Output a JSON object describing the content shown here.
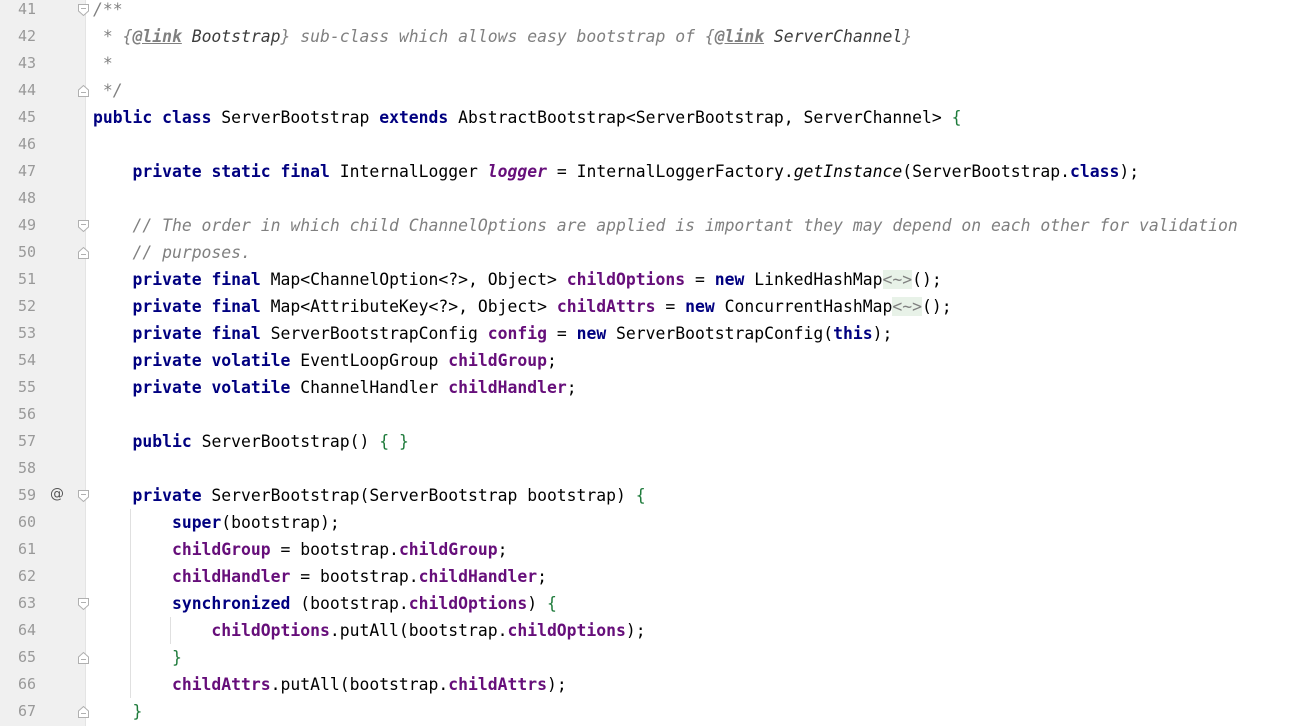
{
  "editor": {
    "line_numbers": [
      "41",
      "42",
      "43",
      "44",
      "45",
      "46",
      "47",
      "48",
      "49",
      "50",
      "51",
      "52",
      "53",
      "54",
      "55",
      "56",
      "57",
      "58",
      "59",
      "60",
      "61",
      "62",
      "63",
      "64",
      "65",
      "66",
      "67"
    ],
    "gutter_icons": {
      "override_marker": "@"
    },
    "lines": [
      [
        {
          "t": "/**",
          "c": "doc"
        }
      ],
      [
        {
          "t": " * {",
          "c": "doc"
        },
        {
          "t": "@link",
          "c": "doc-tag"
        },
        {
          "t": " Bootstrap",
          "c": "doc-link"
        },
        {
          "t": "} sub-class which allows easy bootstrap of {",
          "c": "doc"
        },
        {
          "t": "@link",
          "c": "doc-tag"
        },
        {
          "t": " ServerChannel",
          "c": "doc-link"
        },
        {
          "t": "}",
          "c": "doc"
        }
      ],
      [
        {
          "t": " *",
          "c": "doc"
        }
      ],
      [
        {
          "t": " */",
          "c": "doc"
        }
      ],
      [
        {
          "t": "public",
          "c": "kw"
        },
        {
          "t": " ",
          "c": "plain"
        },
        {
          "t": "class",
          "c": "kw"
        },
        {
          "t": " ServerBootstrap ",
          "c": "plain"
        },
        {
          "t": "extends",
          "c": "kw"
        },
        {
          "t": " AbstractBootstrap<ServerBootstrap, ServerChannel> ",
          "c": "plain"
        },
        {
          "t": "{",
          "c": "brace"
        }
      ],
      [],
      [
        {
          "t": "    ",
          "c": "plain"
        },
        {
          "t": "private",
          "c": "kw"
        },
        {
          "t": " ",
          "c": "plain"
        },
        {
          "t": "static",
          "c": "kw"
        },
        {
          "t": " ",
          "c": "plain"
        },
        {
          "t": "final",
          "c": "kw"
        },
        {
          "t": " InternalLogger ",
          "c": "plain"
        },
        {
          "t": "logger",
          "c": "static-field"
        },
        {
          "t": " = InternalLoggerFactory.",
          "c": "plain"
        },
        {
          "t": "getInstance",
          "c": "method-static"
        },
        {
          "t": "(ServerBootstrap.",
          "c": "plain"
        },
        {
          "t": "class",
          "c": "kw"
        },
        {
          "t": ");",
          "c": "plain"
        }
      ],
      [],
      [
        {
          "t": "    ",
          "c": "plain"
        },
        {
          "t": "// The order in which child ChannelOptions are applied is important they may depend on each other for validation",
          "c": "comment"
        }
      ],
      [
        {
          "t": "    ",
          "c": "plain"
        },
        {
          "t": "// purposes.",
          "c": "comment"
        }
      ],
      [
        {
          "t": "    ",
          "c": "plain"
        },
        {
          "t": "private",
          "c": "kw"
        },
        {
          "t": " ",
          "c": "plain"
        },
        {
          "t": "final",
          "c": "kw"
        },
        {
          "t": " Map<ChannelOption<?>, Object> ",
          "c": "plain"
        },
        {
          "t": "childOptions",
          "c": "field"
        },
        {
          "t": " = ",
          "c": "plain"
        },
        {
          "t": "new",
          "c": "kw"
        },
        {
          "t": " LinkedHashMap",
          "c": "plain"
        },
        {
          "t": "<~>",
          "c": "diamond"
        },
        {
          "t": "();",
          "c": "plain"
        }
      ],
      [
        {
          "t": "    ",
          "c": "plain"
        },
        {
          "t": "private",
          "c": "kw"
        },
        {
          "t": " ",
          "c": "plain"
        },
        {
          "t": "final",
          "c": "kw"
        },
        {
          "t": " Map<AttributeKey<?>, Object> ",
          "c": "plain"
        },
        {
          "t": "childAttrs",
          "c": "field"
        },
        {
          "t": " = ",
          "c": "plain"
        },
        {
          "t": "new",
          "c": "kw"
        },
        {
          "t": " ConcurrentHashMap",
          "c": "plain"
        },
        {
          "t": "<~>",
          "c": "diamond"
        },
        {
          "t": "();",
          "c": "plain"
        }
      ],
      [
        {
          "t": "    ",
          "c": "plain"
        },
        {
          "t": "private",
          "c": "kw"
        },
        {
          "t": " ",
          "c": "plain"
        },
        {
          "t": "final",
          "c": "kw"
        },
        {
          "t": " ServerBootstrapConfig ",
          "c": "plain"
        },
        {
          "t": "config",
          "c": "field"
        },
        {
          "t": " = ",
          "c": "plain"
        },
        {
          "t": "new",
          "c": "kw"
        },
        {
          "t": " ServerBootstrapConfig(",
          "c": "plain"
        },
        {
          "t": "this",
          "c": "kw"
        },
        {
          "t": ");",
          "c": "plain"
        }
      ],
      [
        {
          "t": "    ",
          "c": "plain"
        },
        {
          "t": "private",
          "c": "kw"
        },
        {
          "t": " ",
          "c": "plain"
        },
        {
          "t": "volatile",
          "c": "kw"
        },
        {
          "t": " EventLoopGroup ",
          "c": "plain"
        },
        {
          "t": "childGroup",
          "c": "field"
        },
        {
          "t": ";",
          "c": "plain"
        }
      ],
      [
        {
          "t": "    ",
          "c": "plain"
        },
        {
          "t": "private",
          "c": "kw"
        },
        {
          "t": " ",
          "c": "plain"
        },
        {
          "t": "volatile",
          "c": "kw"
        },
        {
          "t": " ChannelHandler ",
          "c": "plain"
        },
        {
          "t": "childHandler",
          "c": "field"
        },
        {
          "t": ";",
          "c": "plain"
        }
      ],
      [],
      [
        {
          "t": "    ",
          "c": "plain"
        },
        {
          "t": "public",
          "c": "kw"
        },
        {
          "t": " ServerBootstrap() ",
          "c": "plain"
        },
        {
          "t": "{ }",
          "c": "brace"
        }
      ],
      [],
      [
        {
          "t": "    ",
          "c": "plain"
        },
        {
          "t": "private",
          "c": "kw"
        },
        {
          "t": " ServerBootstrap(ServerBootstrap bootstrap) ",
          "c": "plain"
        },
        {
          "t": "{",
          "c": "brace"
        }
      ],
      [
        {
          "t": "        ",
          "c": "plain"
        },
        {
          "t": "super",
          "c": "kw"
        },
        {
          "t": "(bootstrap);",
          "c": "plain"
        }
      ],
      [
        {
          "t": "        ",
          "c": "plain"
        },
        {
          "t": "childGroup",
          "c": "field"
        },
        {
          "t": " = bootstrap.",
          "c": "plain"
        },
        {
          "t": "childGroup",
          "c": "field"
        },
        {
          "t": ";",
          "c": "plain"
        }
      ],
      [
        {
          "t": "        ",
          "c": "plain"
        },
        {
          "t": "childHandler",
          "c": "field"
        },
        {
          "t": " = bootstrap.",
          "c": "plain"
        },
        {
          "t": "childHandler",
          "c": "field"
        },
        {
          "t": ";",
          "c": "plain"
        }
      ],
      [
        {
          "t": "        ",
          "c": "plain"
        },
        {
          "t": "synchronized",
          "c": "kw"
        },
        {
          "t": " (bootstrap.",
          "c": "plain"
        },
        {
          "t": "childOptions",
          "c": "field"
        },
        {
          "t": ") ",
          "c": "plain"
        },
        {
          "t": "{",
          "c": "brace"
        }
      ],
      [
        {
          "t": "            ",
          "c": "plain"
        },
        {
          "t": "childOptions",
          "c": "field"
        },
        {
          "t": ".putAll(bootstrap.",
          "c": "plain"
        },
        {
          "t": "childOptions",
          "c": "field"
        },
        {
          "t": ");",
          "c": "plain"
        }
      ],
      [
        {
          "t": "        ",
          "c": "plain"
        },
        {
          "t": "}",
          "c": "brace"
        }
      ],
      [
        {
          "t": "        ",
          "c": "plain"
        },
        {
          "t": "childAttrs",
          "c": "field"
        },
        {
          "t": ".putAll(bootstrap.",
          "c": "plain"
        },
        {
          "t": "childAttrs",
          "c": "field"
        },
        {
          "t": ");",
          "c": "plain"
        }
      ],
      [
        {
          "t": "    ",
          "c": "plain"
        },
        {
          "t": "}",
          "c": "brace"
        }
      ]
    ]
  }
}
